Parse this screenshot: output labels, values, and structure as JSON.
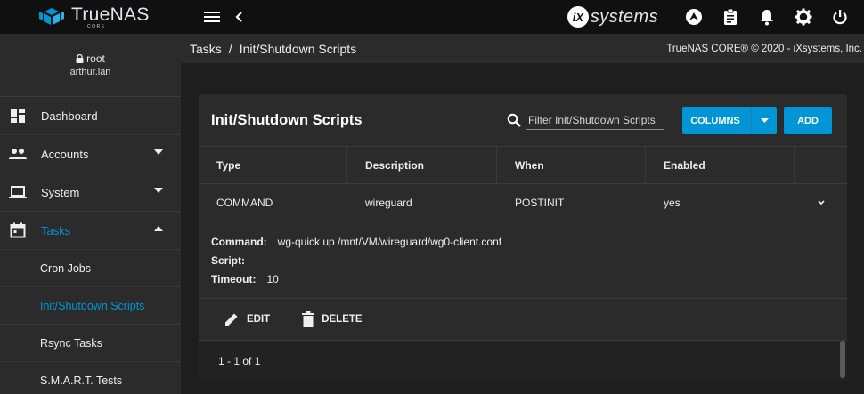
{
  "brand": {
    "name": "TrueNAS",
    "sub": "CORE"
  },
  "header": {
    "vendor_logo_text": "systems",
    "vendor_logo_mark": "iX"
  },
  "user": {
    "name": "root",
    "host": "arthur.lan"
  },
  "nav": {
    "items": [
      {
        "label": "Dashboard",
        "icon": "dashboard-icon"
      },
      {
        "label": "Accounts",
        "icon": "people-icon"
      },
      {
        "label": "System",
        "icon": "laptop-icon"
      },
      {
        "label": "Tasks",
        "icon": "calendar-icon"
      }
    ],
    "sub_items": [
      "Cron Jobs",
      "Init/Shutdown Scripts",
      "Rsync Tasks",
      "S.M.A.R.T. Tests"
    ]
  },
  "breadcrumb": {
    "parent": "Tasks",
    "separator": "/",
    "current": "Init/Shutdown Scripts"
  },
  "copyright": "TrueNAS CORE® © 2020 - iXsystems, Inc.",
  "card": {
    "title": "Init/Shutdown Scripts",
    "search_placeholder": "Filter Init/Shutdown Scripts",
    "columns_label": "COLUMNS",
    "add_label": "ADD",
    "headers": [
      "Type",
      "Description",
      "When",
      "Enabled"
    ],
    "row": {
      "type": "COMMAND",
      "description": "wireguard",
      "when": "POSTINIT",
      "enabled": "yes"
    },
    "details": {
      "command_key": "Command:",
      "command_val": "wg-quick up /mnt/VM/wireguard/wg0-client.conf",
      "script_key": "Script:",
      "script_val": "",
      "timeout_key": "Timeout:",
      "timeout_val": "10"
    },
    "edit_label": "EDIT",
    "delete_label": "DELETE",
    "pagination": "1 - 1 of 1"
  },
  "colors": {
    "accent": "#0095d5",
    "topbar": "#101010",
    "panel": "#2b2b2b"
  }
}
